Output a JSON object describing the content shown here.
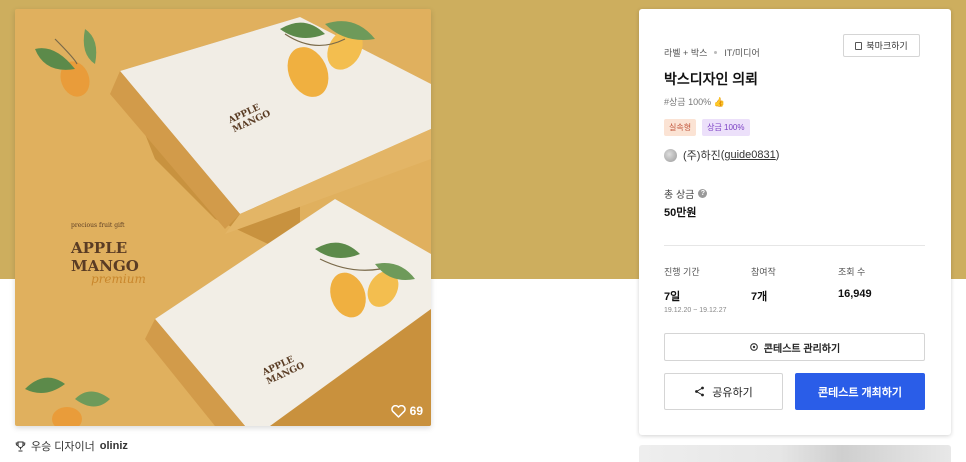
{
  "hero": {
    "label_small": "precious fruit gift",
    "brand_line1": "APPLE",
    "brand_line2": "MANGO",
    "brand_script": "premium",
    "likes": "69"
  },
  "designer": {
    "prefix": "우승 디자이너",
    "name": "oliniz"
  },
  "contest": {
    "category1": "라벨 + 박스",
    "category2": "IT/미디어",
    "bookmark_label": "북마크하기",
    "title": "박스디자인 의뢰",
    "hashtag": "#상금 100% 👍",
    "badge1": "실속형",
    "badge2": "상금 100%",
    "company": "(주)하진",
    "company_id": "guide0831",
    "prize_label": "총 상금",
    "prize_value": "50만원",
    "stats": {
      "period_label": "진행 기간",
      "period_value": "7일",
      "period_dates": "19.12.20 ~ 19.12.27",
      "entries_label": "참여작",
      "entries_value": "7개",
      "views_label": "조회 수",
      "views_value": "16,949"
    },
    "manage_label": "콘테스트 관리하기",
    "share_label": "공유하기",
    "host_label": "콘테스트 개최하기"
  },
  "colors": {
    "banner": "#cdae5e",
    "primary_button": "#2a5de8"
  }
}
